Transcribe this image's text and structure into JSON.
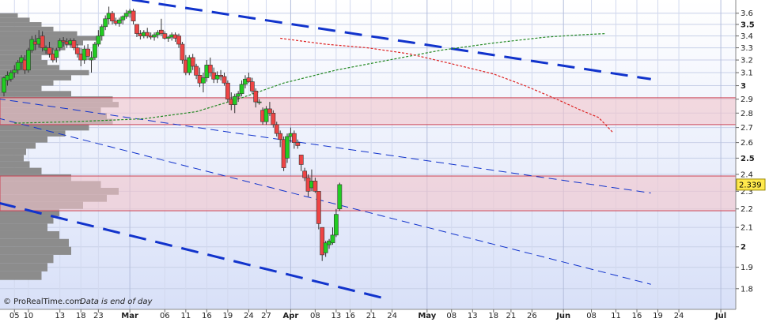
{
  "chart_data": {
    "type": "candlestick",
    "y_axis": {
      "min": 1.75,
      "max": 3.62,
      "scale": "log",
      "position": "right",
      "ticks": [
        "1.8",
        "1.9",
        "2",
        "2.1",
        "2.2",
        "2.3",
        "2.4",
        "2.5",
        "2.6",
        "2.7",
        "2.8",
        "2.9",
        "3",
        "3.1",
        "3.2",
        "3.3",
        "3.4",
        "3.5",
        "3.6"
      ],
      "bold_ticks": [
        "2",
        "2.5",
        "3",
        "3.5"
      ]
    },
    "x_axis": {
      "ticks": [
        {
          "label": "05",
          "bold": false
        },
        {
          "label": "10",
          "bold": false
        },
        {
          "label": "13",
          "bold": false
        },
        {
          "label": "18",
          "bold": false
        },
        {
          "label": "23",
          "bold": false
        },
        {
          "label": "Mar",
          "bold": true
        },
        {
          "label": "06",
          "bold": false
        },
        {
          "label": "11",
          "bold": false
        },
        {
          "label": "16",
          "bold": false
        },
        {
          "label": "19",
          "bold": false
        },
        {
          "label": "24",
          "bold": false
        },
        {
          "label": "27",
          "bold": false
        },
        {
          "label": "Apr",
          "bold": true
        },
        {
          "label": "08",
          "bold": false
        },
        {
          "label": "13",
          "bold": false
        },
        {
          "label": "16",
          "bold": false
        },
        {
          "label": "21",
          "bold": false
        },
        {
          "label": "24",
          "bold": false
        },
        {
          "label": "May",
          "bold": true
        },
        {
          "label": "08",
          "bold": false
        },
        {
          "label": "13",
          "bold": false
        },
        {
          "label": "18",
          "bold": false
        },
        {
          "label": "21",
          "bold": false
        },
        {
          "label": "26",
          "bold": false
        },
        {
          "label": "Jun",
          "bold": true
        },
        {
          "label": "08",
          "bold": false
        },
        {
          "label": "11",
          "bold": false
        },
        {
          "label": "16",
          "bold": false
        },
        {
          "label": "19",
          "bold": false
        },
        {
          "label": "24",
          "bold": false
        },
        {
          "label": "Jul",
          "bold": true
        }
      ]
    },
    "last_price": "2.339",
    "zones": [
      {
        "from": 2.72,
        "to": 2.91
      },
      {
        "from": 2.19,
        "to": 2.39
      }
    ],
    "colors": {
      "up": "#22cc22",
      "down": "#ee4444",
      "zone_fill": "#f2c4cc",
      "zone_border": "#cc4455",
      "trend": "#1133cc",
      "ma_long": "#dd2222",
      "ma_short": "#228822",
      "volume_profile": "#8c8c8c",
      "background_top": "#ffffff",
      "background_bottom": "#d8e0f8"
    },
    "candles": [
      [
        2.95,
        3.07,
        2.92,
        3.06
      ],
      [
        3.04,
        3.11,
        3.0,
        3.08
      ],
      [
        3.05,
        3.12,
        3.03,
        3.1
      ],
      [
        3.1,
        3.16,
        3.06,
        3.12
      ],
      [
        3.12,
        3.2,
        3.09,
        3.18
      ],
      [
        3.18,
        3.24,
        3.12,
        3.22
      ],
      [
        3.2,
        3.24,
        3.09,
        3.12
      ],
      [
        3.12,
        3.3,
        3.1,
        3.28
      ],
      [
        3.28,
        3.4,
        3.26,
        3.37
      ],
      [
        3.35,
        3.41,
        3.28,
        3.33
      ],
      [
        3.33,
        3.45,
        3.3,
        3.38
      ],
      [
        3.4,
        3.44,
        3.27,
        3.3
      ],
      [
        3.28,
        3.32,
        3.25,
        3.3
      ],
      [
        3.3,
        3.35,
        3.22,
        3.25
      ],
      [
        3.25,
        3.3,
        3.18,
        3.2
      ],
      [
        3.22,
        3.3,
        3.18,
        3.28
      ],
      [
        3.3,
        3.38,
        3.27,
        3.36
      ],
      [
        3.36,
        3.39,
        3.31,
        3.35
      ],
      [
        3.35,
        3.38,
        3.3,
        3.33
      ],
      [
        3.33,
        3.38,
        3.3,
        3.36
      ],
      [
        3.36,
        3.38,
        3.28,
        3.3
      ],
      [
        3.3,
        3.33,
        3.22,
        3.25
      ],
      [
        3.25,
        3.3,
        3.15,
        3.2
      ],
      [
        3.2,
        3.32,
        3.17,
        3.29
      ],
      [
        3.29,
        3.33,
        3.2,
        3.23
      ],
      [
        3.2,
        3.27,
        3.1,
        3.22
      ],
      [
        3.22,
        3.35,
        3.2,
        3.33
      ],
      [
        3.33,
        3.45,
        3.31,
        3.4
      ],
      [
        3.4,
        3.5,
        3.36,
        3.48
      ],
      [
        3.48,
        3.58,
        3.45,
        3.55
      ],
      [
        3.55,
        3.66,
        3.5,
        3.6
      ],
      [
        3.6,
        3.62,
        3.5,
        3.53
      ],
      [
        3.53,
        3.56,
        3.49,
        3.51
      ],
      [
        3.51,
        3.56,
        3.48,
        3.54
      ],
      [
        3.54,
        3.58,
        3.5,
        3.57
      ],
      [
        3.57,
        3.63,
        3.55,
        3.6
      ],
      [
        3.6,
        3.64,
        3.56,
        3.62
      ],
      [
        3.62,
        3.64,
        3.5,
        3.53
      ],
      [
        3.5,
        3.5,
        3.39,
        3.42
      ],
      [
        3.42,
        3.45,
        3.37,
        3.4
      ],
      [
        3.4,
        3.45,
        3.38,
        3.43
      ],
      [
        3.43,
        3.47,
        3.38,
        3.4
      ],
      [
        3.4,
        3.43,
        3.37,
        3.39
      ],
      [
        3.39,
        3.43,
        3.36,
        3.41
      ],
      [
        3.41,
        3.45,
        3.38,
        3.43
      ],
      [
        3.45,
        3.55,
        3.4,
        3.42
      ],
      [
        3.42,
        3.44,
        3.37,
        3.38
      ],
      [
        3.38,
        3.4,
        3.35,
        3.39
      ],
      [
        3.39,
        3.43,
        3.36,
        3.41
      ],
      [
        3.41,
        3.43,
        3.35,
        3.38
      ],
      [
        3.4,
        3.42,
        3.3,
        3.33
      ],
      [
        3.33,
        3.35,
        3.17,
        3.2
      ],
      [
        3.2,
        3.24,
        3.08,
        3.1
      ],
      [
        3.1,
        3.24,
        3.08,
        3.22
      ],
      [
        3.22,
        3.25,
        3.12,
        3.15
      ],
      [
        3.15,
        3.17,
        3.05,
        3.08
      ],
      [
        3.08,
        3.14,
        2.99,
        3.02
      ],
      [
        3.02,
        3.1,
        2.95,
        3.06
      ],
      [
        3.06,
        3.2,
        3.03,
        3.16
      ],
      [
        3.16,
        3.22,
        3.07,
        3.1
      ],
      [
        3.1,
        3.14,
        3.02,
        3.05
      ],
      [
        3.05,
        3.11,
        3.02,
        3.08
      ],
      [
        3.08,
        3.12,
        3.04,
        3.07
      ],
      [
        3.07,
        3.1,
        3.0,
        3.02
      ],
      [
        3.02,
        3.04,
        2.88,
        2.9
      ],
      [
        2.9,
        2.95,
        2.82,
        2.86
      ],
      [
        2.86,
        2.94,
        2.8,
        2.92
      ],
      [
        2.92,
        2.96,
        2.88,
        2.94
      ],
      [
        2.94,
        3.04,
        2.92,
        3.01
      ],
      [
        3.01,
        3.08,
        2.98,
        3.05
      ],
      [
        3.06,
        3.1,
        3.02,
        3.03
      ],
      [
        3.03,
        3.06,
        2.94,
        2.96
      ],
      [
        2.96,
        2.98,
        2.84,
        2.88
      ],
      [
        2.88,
        2.9,
        2.86,
        2.88
      ],
      [
        2.82,
        2.84,
        2.72,
        2.74
      ],
      [
        2.74,
        2.85,
        2.72,
        2.83
      ],
      [
        2.83,
        2.88,
        2.78,
        2.8
      ],
      [
        2.8,
        2.82,
        2.7,
        2.72
      ],
      [
        2.72,
        2.74,
        2.64,
        2.66
      ],
      [
        2.66,
        2.68,
        2.57,
        2.62
      ],
      [
        2.62,
        2.64,
        2.42,
        2.44
      ],
      [
        2.5,
        2.66,
        2.47,
        2.64
      ],
      [
        2.64,
        2.7,
        2.6,
        2.66
      ],
      [
        2.66,
        2.68,
        2.56,
        2.6
      ],
      [
        2.6,
        2.62,
        2.56,
        2.58
      ],
      [
        2.52,
        2.52,
        2.42,
        2.46
      ],
      [
        2.42,
        2.44,
        2.36,
        2.38
      ],
      [
        2.38,
        2.4,
        2.27,
        2.3
      ],
      [
        2.32,
        2.43,
        2.3,
        2.36
      ],
      [
        2.36,
        2.38,
        2.29,
        2.3
      ],
      [
        2.3,
        2.3,
        2.09,
        2.12
      ],
      [
        2.1,
        2.1,
        1.93,
        1.96
      ],
      [
        1.97,
        2.03,
        1.95,
        2.02
      ],
      [
        2.01,
        2.04,
        1.99,
        2.03
      ],
      [
        2.02,
        2.1,
        2.01,
        2.06
      ],
      [
        2.06,
        2.2,
        2.05,
        2.17
      ],
      [
        2.2,
        2.35,
        2.19,
        2.339
      ]
    ],
    "ma_long": [
      [
        79,
        3.38
      ],
      [
        92,
        3.33
      ],
      [
        104,
        3.3
      ],
      [
        116,
        3.25
      ],
      [
        128,
        3.17
      ],
      [
        140,
        3.09
      ],
      [
        149,
        3.0
      ],
      [
        158,
        2.9
      ],
      [
        165,
        2.82
      ],
      [
        170,
        2.77
      ],
      [
        174,
        2.67
      ]
    ],
    "ma_short": [
      [
        3,
        2.73
      ],
      [
        20,
        2.74
      ],
      [
        40,
        2.76
      ],
      [
        55,
        2.81
      ],
      [
        68,
        2.91
      ],
      [
        80,
        3.02
      ],
      [
        95,
        3.12
      ],
      [
        110,
        3.2
      ],
      [
        125,
        3.28
      ],
      [
        140,
        3.34
      ],
      [
        155,
        3.39
      ],
      [
        165,
        3.41
      ],
      [
        172,
        3.42
      ]
    ],
    "trendlines": [
      {
        "from": [
          -9,
          3.96
        ],
        "to": [
          185,
          3.05
        ],
        "style": "long-dash",
        "width": 3
      },
      {
        "from": [
          -9,
          2.93
        ],
        "to": [
          185,
          2.29
        ],
        "style": "dash",
        "width": 1
      },
      {
        "from": [
          -9,
          2.81
        ],
        "to": [
          185,
          1.82
        ],
        "style": "dash",
        "width": 1
      },
      {
        "from": [
          -9,
          2.27
        ],
        "to": [
          108,
          1.76
        ],
        "style": "long-dash",
        "width": 3
      }
    ],
    "volume_profile": [
      [
        1.86,
        0.35
      ],
      [
        1.9,
        0.4
      ],
      [
        1.94,
        0.45
      ],
      [
        1.98,
        0.6
      ],
      [
        2.02,
        0.58
      ],
      [
        2.06,
        0.5
      ],
      [
        2.1,
        0.4
      ],
      [
        2.14,
        0.45
      ],
      [
        2.18,
        0.5
      ],
      [
        2.22,
        0.7
      ],
      [
        2.26,
        0.9
      ],
      [
        2.3,
        1.0
      ],
      [
        2.34,
        0.85
      ],
      [
        2.38,
        0.6
      ],
      [
        2.42,
        0.35
      ],
      [
        2.46,
        0.25
      ],
      [
        2.5,
        0.2
      ],
      [
        2.54,
        0.22
      ],
      [
        2.58,
        0.3
      ],
      [
        2.62,
        0.4
      ],
      [
        2.66,
        0.55
      ],
      [
        2.7,
        0.75
      ],
      [
        2.74,
        0.95
      ],
      [
        2.78,
        0.9
      ],
      [
        2.82,
        0.85
      ],
      [
        2.86,
        1.0
      ],
      [
        2.9,
        0.95
      ],
      [
        2.94,
        0.6
      ],
      [
        2.98,
        0.35
      ],
      [
        3.02,
        0.45
      ],
      [
        3.06,
        0.6
      ],
      [
        3.1,
        0.75
      ],
      [
        3.14,
        0.5
      ],
      [
        3.18,
        0.4
      ],
      [
        3.22,
        0.35
      ],
      [
        3.26,
        0.45
      ],
      [
        3.3,
        0.55
      ],
      [
        3.34,
        0.7
      ],
      [
        3.38,
        0.85
      ],
      [
        3.42,
        0.65
      ],
      [
        3.46,
        0.45
      ],
      [
        3.5,
        0.35
      ],
      [
        3.54,
        0.25
      ],
      [
        3.58,
        0.15
      ]
    ]
  },
  "footer": {
    "brand": "© ProRealTime.com",
    "note": "Data is end of day"
  }
}
